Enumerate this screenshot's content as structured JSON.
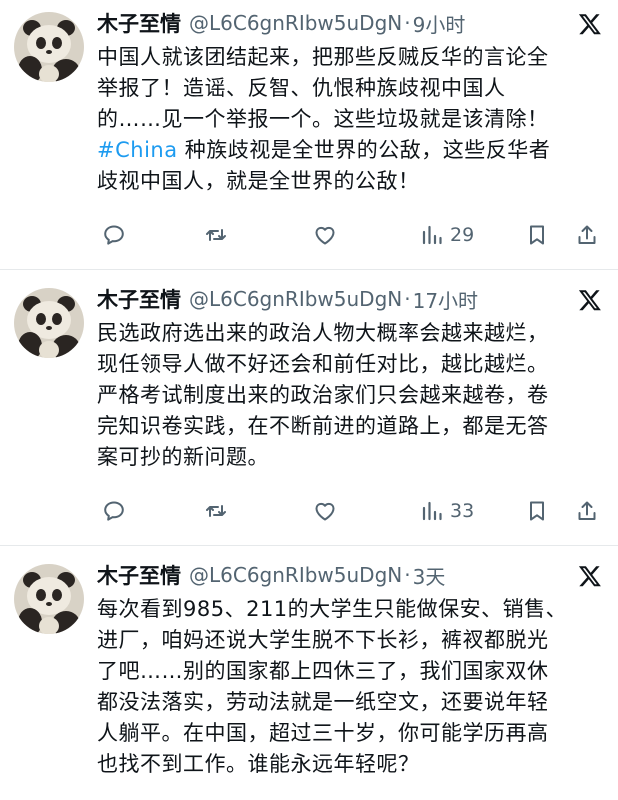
{
  "tweets": [
    {
      "name": "木子至情",
      "handle": "@L6C6gnRIbw5uDgN",
      "separator": "·",
      "time": "9小时",
      "lines": [
        "中国人就该团结起来，把那些反贼反华的言论全",
        "举报了！造谣、反智、仇恨种族歧视中国人",
        "的……见一个举报一个。这些垃圾就是该清除！"
      ],
      "hashtag": "#China",
      "hashtag_line_rest": " 种族歧视是全世界的公敌，这些反华者",
      "last_line": "歧视中国人，就是全世界的公敌！",
      "views": "29"
    },
    {
      "name": "木子至情",
      "handle": "@L6C6gnRIbw5uDgN",
      "separator": "·",
      "time": "17小时",
      "lines": [
        "民选政府选出来的政治人物大概率会越来越烂，",
        "现任领导人做不好还会和前任对比，越比越烂。",
        "严格考试制度出来的政治家们只会越来越卷，卷",
        "完知识卷实践，在不断前进的道路上，都是无答",
        "案可抄的新问题。"
      ],
      "views": "33"
    },
    {
      "name": "木子至情",
      "handle": "@L6C6gnRIbw5uDgN",
      "separator": "·",
      "time": "3天",
      "lines": [
        "每次看到985、211的大学生只能做保安、销售、",
        "进厂，咱妈还说大学生脱不下长衫，裤衩都脱光",
        "了吧……别的国家都上四休三了，我们国家双休",
        "都没法落实，劳动法就是一纸空文，还要说年轻",
        "人躺平。在中国，超过三十岁，你可能学历再高",
        "也找不到工作。谁能永远年轻呢？"
      ]
    }
  ],
  "icons": {
    "reply": "reply-icon",
    "retweet": "retweet-icon",
    "like": "heart-icon",
    "views": "views-icon",
    "bookmark": "bookmark-icon",
    "share": "share-icon",
    "platform": "x-logo-icon"
  },
  "colors": {
    "text": "#0f1419",
    "secondary": "#536471",
    "hashtag": "#1d9bf0",
    "divider": "#e6e9eb"
  }
}
